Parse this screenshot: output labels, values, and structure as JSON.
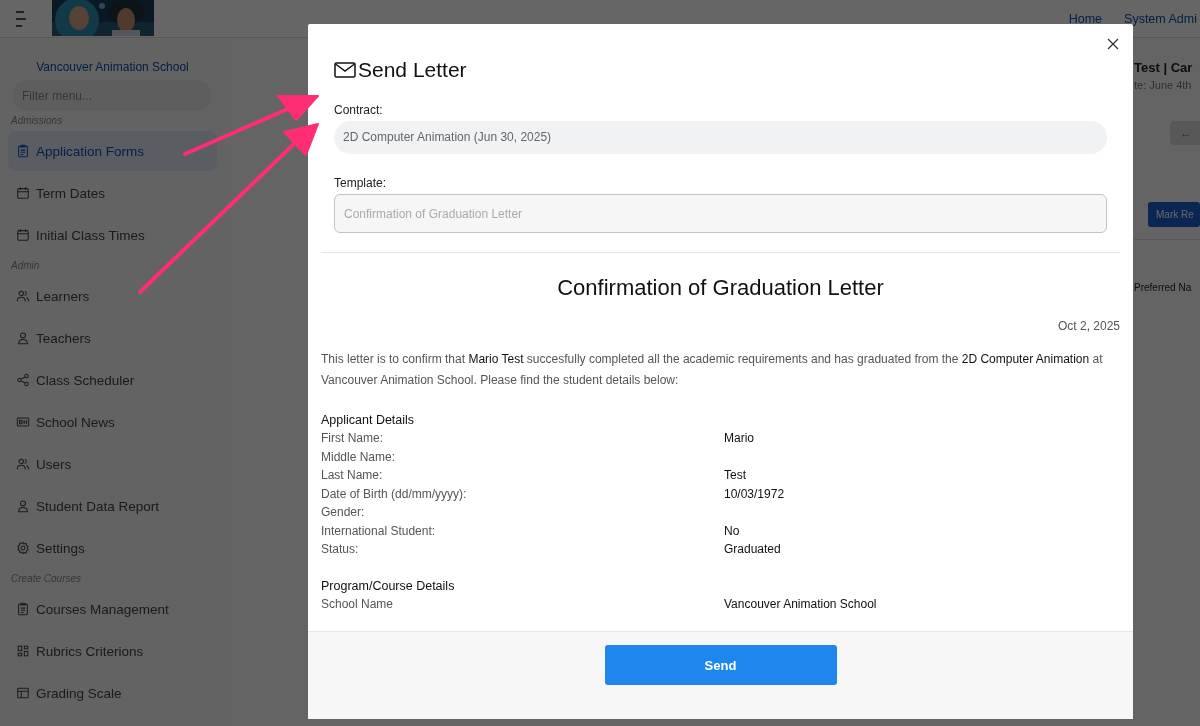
{
  "header": {
    "nav_links": [
      "Home",
      "System Admi"
    ]
  },
  "sidebar": {
    "school_name": "Vancouver Animation School",
    "filter": {
      "placeholder": "Filter menu..."
    },
    "sections": [
      {
        "label": "Admissions",
        "items": [
          {
            "label": "Application Forms",
            "selected": true
          },
          {
            "label": "Term Dates",
            "selected": false
          },
          {
            "label": "Initial Class Times",
            "selected": false
          }
        ]
      },
      {
        "label": "Admin",
        "items": [
          {
            "label": "Learners",
            "selected": false
          },
          {
            "label": "Teachers",
            "selected": false
          },
          {
            "label": "Class Scheduler",
            "selected": false
          },
          {
            "label": "School News",
            "selected": false
          },
          {
            "label": "Users",
            "selected": false
          },
          {
            "label": "Student Data Report",
            "selected": false
          },
          {
            "label": "Settings",
            "selected": false
          }
        ]
      },
      {
        "label": "Create Courses",
        "items": [
          {
            "label": "Courses Management",
            "selected": false
          },
          {
            "label": "Rubrics Criterions",
            "selected": false
          },
          {
            "label": "Grading Scale",
            "selected": false
          }
        ]
      }
    ]
  },
  "main": {
    "title": "Test | Car",
    "subtitle": "te: June 4th",
    "back_button": "←",
    "action_button": "Mark Re",
    "column_label": "Preferred Na"
  },
  "modal": {
    "title": "Send Letter",
    "fields": [
      {
        "label": "Contract:",
        "value": "2D Computer Animation (Jun 30, 2025)",
        "kind": "pill"
      },
      {
        "label": "Template:",
        "placeholder": "Confirmation of Graduation Letter",
        "kind": "box"
      }
    ],
    "letter": {
      "heading": "Confirmation of Graduation Letter",
      "date": "Oct 2, 2025",
      "paragraph": "This letter is to confirm that **Mario Test** succesfully completed all the academic requirements and has graduated from the **2D Computer Animation** at Vancouver Animation School.  Please find the student details below:",
      "sections": [
        {
          "heading": "Applicant Details",
          "rows": [
            {
              "label": "First Name:",
              "value": "Mario"
            },
            {
              "label": "Middle Name:"
            },
            {
              "label": "Last Name:",
              "value": "Test"
            },
            {
              "label": "Date of Birth (dd/mm/yyyy):",
              "value": "10/03/1972"
            },
            {
              "label": "Gender:"
            },
            {
              "label": "International Student:",
              "value": "No"
            },
            {
              "label": "Status:",
              "value": "Graduated"
            }
          ]
        },
        {
          "heading": "Program/Course Details",
          "rows": [
            {
              "label": "School Name",
              "value": "Vancouver Animation School"
            }
          ]
        }
      ]
    },
    "send_button": "Send"
  }
}
